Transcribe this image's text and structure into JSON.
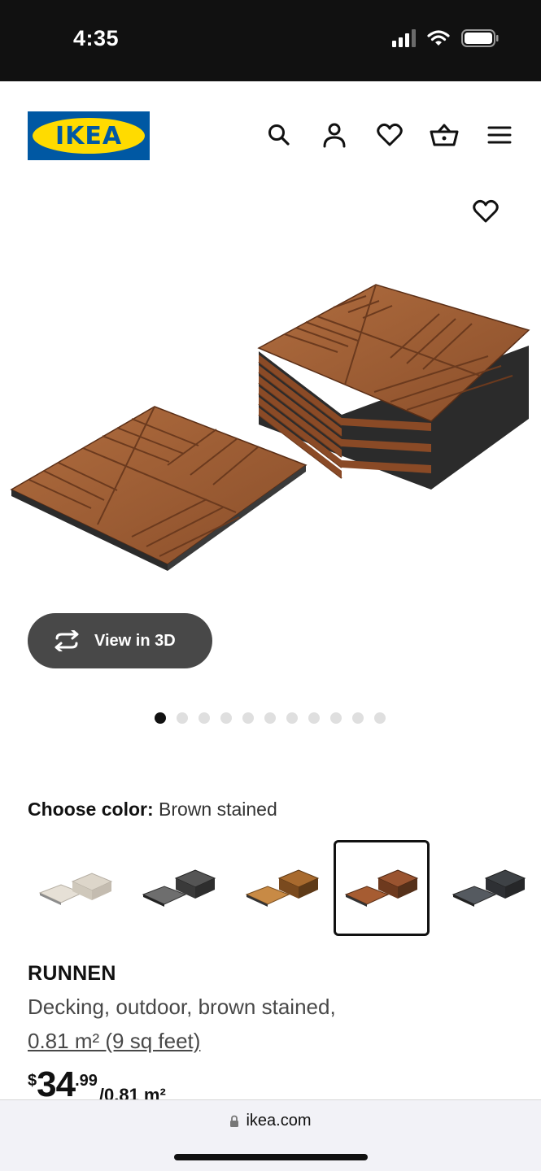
{
  "status_bar": {
    "time": "4:35"
  },
  "header": {
    "logo_text": "IKEA",
    "icons": [
      "search-icon",
      "account-icon",
      "heart-icon",
      "basket-icon",
      "menu-icon"
    ]
  },
  "gallery": {
    "view_3d_label": "View in 3D",
    "dot_count": 11,
    "active_dot": 1
  },
  "color_choice": {
    "label": "Choose color:",
    "selected": "Brown stained",
    "swatches": [
      "light-grey-beige",
      "dark-grey",
      "light-brown",
      "brown-stained",
      "grey-stone"
    ],
    "selected_index": 4
  },
  "product": {
    "name": "RUNNEN",
    "description": "Decking, outdoor, brown stained,",
    "size": "0.81 m² (9 sq feet)",
    "price_currency": "$",
    "price_integer": "34",
    "price_decimal": ".99",
    "price_unit": "/0.81 m²"
  },
  "browser": {
    "url": "ikea.com"
  },
  "colors": {
    "ikea_blue": "#0058a3",
    "ikea_yellow": "#ffdb00",
    "wood": "#9a5a34",
    "button_dark": "#484848"
  }
}
